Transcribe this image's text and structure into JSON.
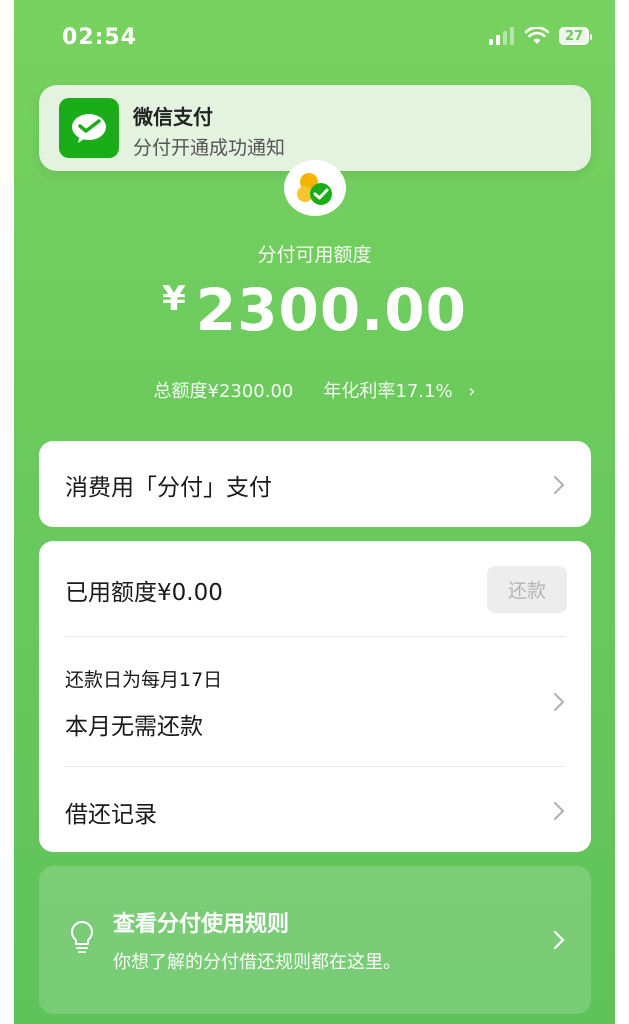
{
  "status_bar": {
    "time": "02:54",
    "battery": "27"
  },
  "notification": {
    "app": "微信支付",
    "message": "分付开通成功通知"
  },
  "credit": {
    "label": "分付可用额度",
    "currency": "¥",
    "amount": "2300.00",
    "total": "总额度¥2300.00",
    "rate": "年化利率17.1%"
  },
  "pay_card": {
    "label": "消费用「分付」支付"
  },
  "usage_card": {
    "used": "已用额度¥0.00",
    "repay_button": "还款",
    "due_day": "还款日为每月17日",
    "due_status": "本月无需还款",
    "records": "借还记录"
  },
  "rules_card": {
    "title": "查看分付使用规则",
    "description": "你想了解的分付借还规则都在这里。"
  },
  "colors": {
    "background": "#6cca5d",
    "wechat_green": "#1aad19"
  }
}
